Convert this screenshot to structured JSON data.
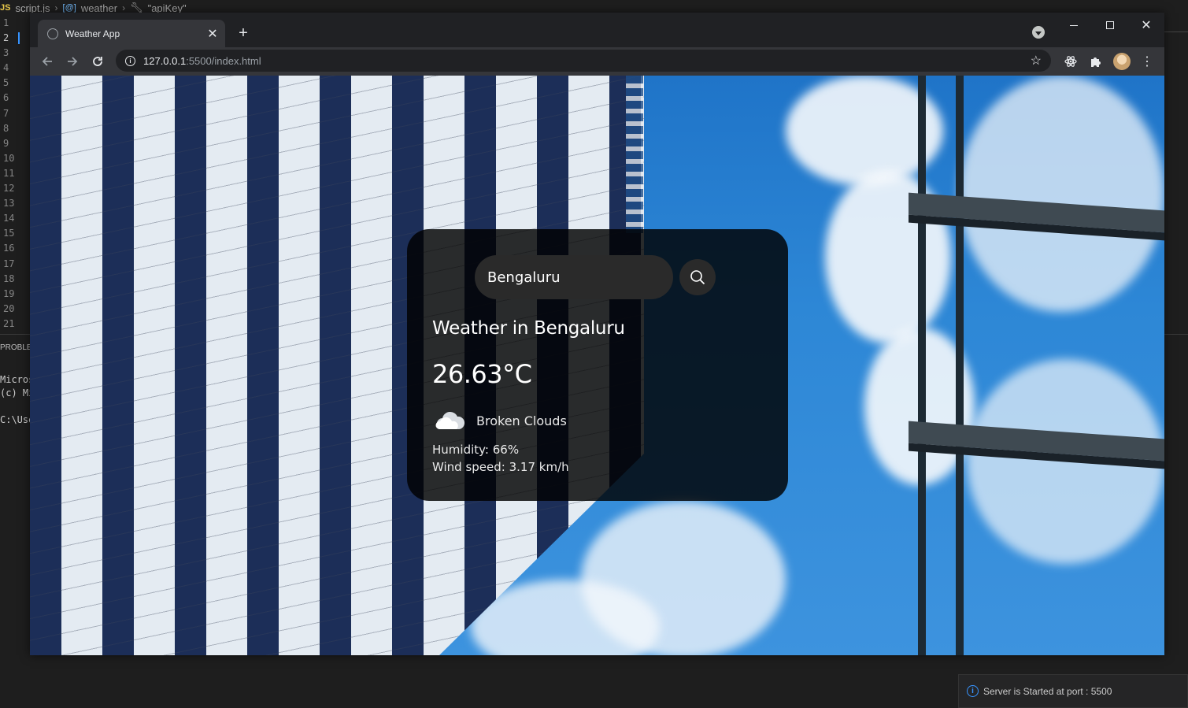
{
  "editor": {
    "breadcrumb": {
      "file_icon": "JS",
      "file": "script.js",
      "symbol_icon": "[@]",
      "symbol": "weather",
      "property": "\"apiKey\""
    },
    "line_numbers": [
      "1",
      "2",
      "3",
      "4",
      "5",
      "6",
      "7",
      "8",
      "9",
      "10",
      "11",
      "12",
      "13",
      "14",
      "15",
      "16",
      "17",
      "18",
      "19",
      "20",
      "21"
    ],
    "panel_tab": "PROBLE",
    "terminal_lines": [
      "Micros",
      "(c) Mi",
      "",
      "C:\\Use"
    ],
    "notification": "Server is Started at port : 5500"
  },
  "browser": {
    "tab_title": "Weather App",
    "url_host": "127.0.0.1",
    "url_path": ":5500/index.html"
  },
  "weather": {
    "search_value": "Bengaluru",
    "heading": "Weather in Bengaluru",
    "temperature": "26.63°C",
    "description": "Broken Clouds",
    "humidity": "Humidity: 66%",
    "wind": "Wind speed: 3.17 km/h",
    "weather_icon": "cloud-icon"
  },
  "colors": {
    "card_bg": "rgba(0,0,0,0.82)",
    "accent_blue": "#3794ff"
  }
}
